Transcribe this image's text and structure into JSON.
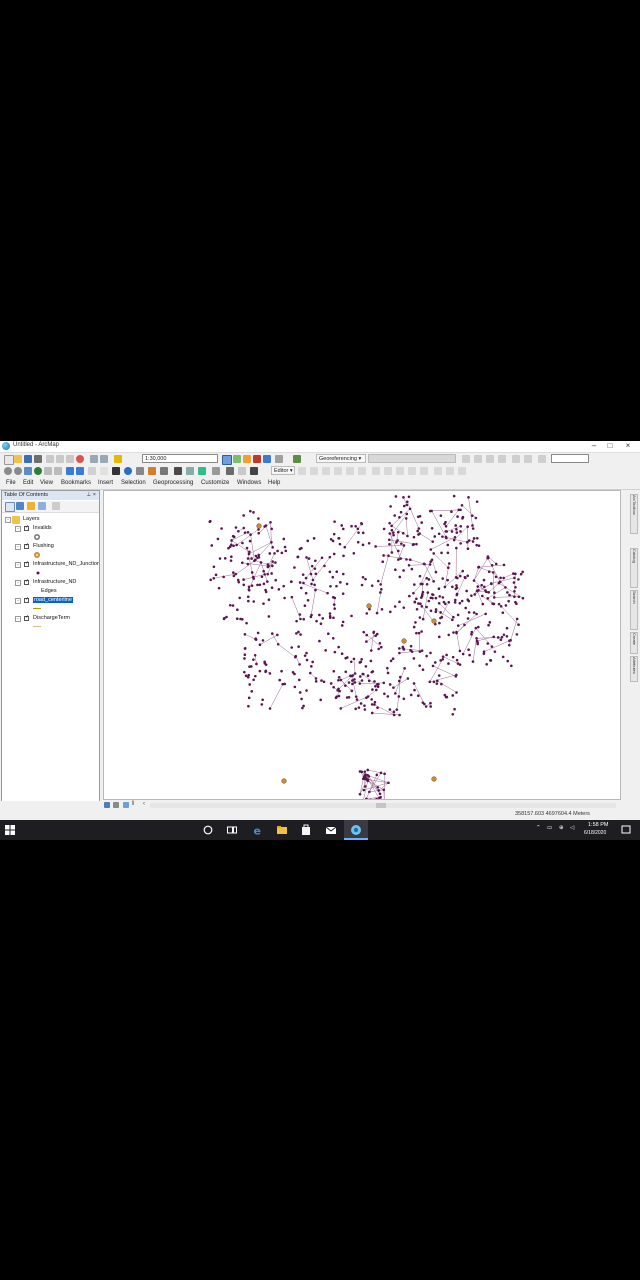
{
  "window": {
    "title": "Untitled - ArcMap",
    "minimize": "–",
    "maximize": "□",
    "close": "×"
  },
  "toolbar": {
    "scale": "1:30,000",
    "georeferencing_label": "Georeferencing ▾",
    "editor_label": "Editor ▾"
  },
  "menus": [
    "File",
    "Edit",
    "View",
    "Bookmarks",
    "Insert",
    "Selection",
    "Geoprocessing",
    "Customize",
    "Windows",
    "Help"
  ],
  "toc": {
    "title": "Table Of Contents",
    "pin": "⊥ ×",
    "root": "Layers",
    "layers": [
      {
        "name": "Invalids",
        "checked": true
      },
      {
        "name": "Flushing",
        "checked": true
      },
      {
        "name": "Infrastructure_ND_Junctions",
        "checked": true
      },
      {
        "name": "Infrastructure_ND",
        "checked": true,
        "sublabel": "Edges"
      },
      {
        "name": "road_centerline",
        "checked": true,
        "selected": true
      },
      {
        "name": "DischargeTerm",
        "checked": true
      }
    ]
  },
  "right_dock": [
    "ArcToolbox",
    "Catalog",
    "Search",
    "Create Features",
    "Attributes"
  ],
  "status": {
    "coordinates": "358157.603 4697604.4 Meters"
  },
  "taskbar": {
    "time": "1:58 PM",
    "date": "6/18/2020"
  },
  "colors": {
    "network": "#5a1550",
    "accent": "#1e6ab3",
    "selection": "#0a64c8"
  }
}
